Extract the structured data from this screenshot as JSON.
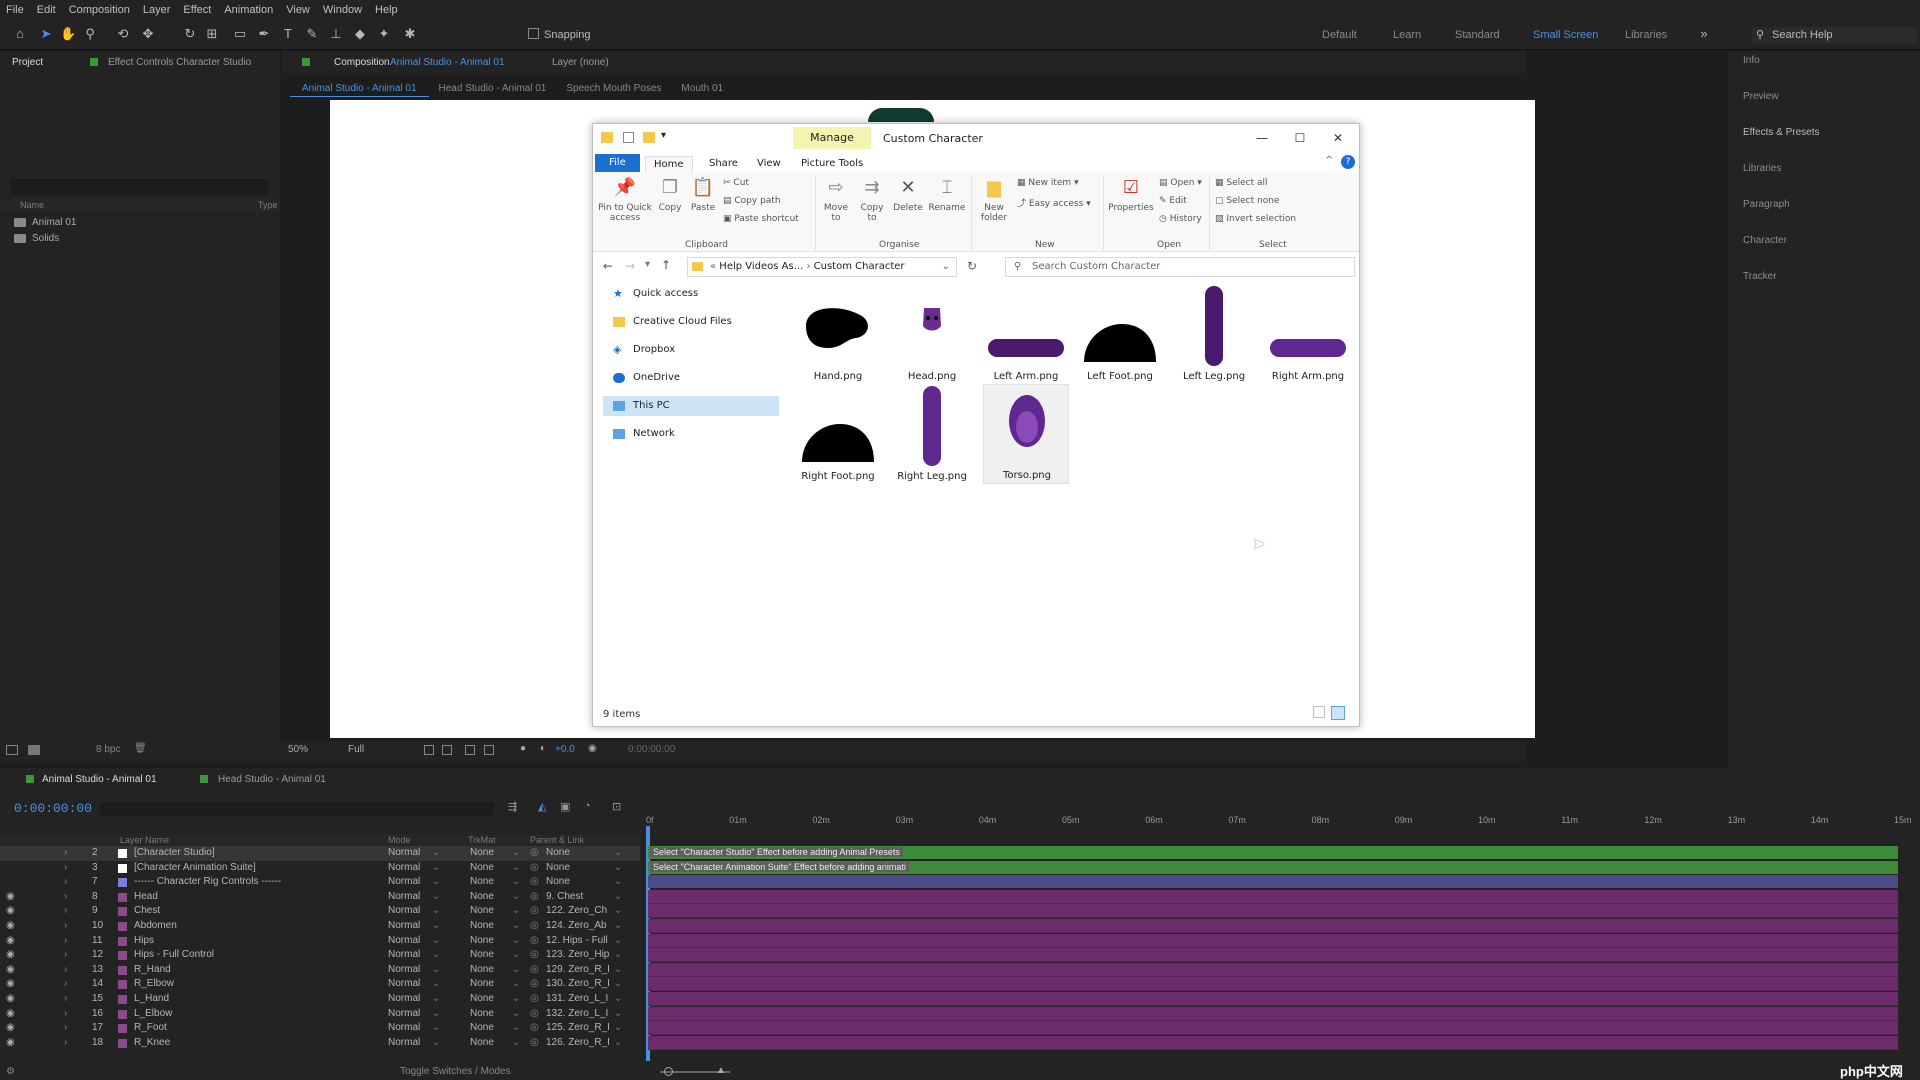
{
  "menu": [
    "File",
    "Edit",
    "Composition",
    "Layer",
    "Effect",
    "Animation",
    "View",
    "Window",
    "Help"
  ],
  "toolbar": {
    "snapping": "Snapping",
    "workspaces": [
      "Default",
      "Learn",
      "Standard",
      "Small Screen",
      "Libraries"
    ],
    "search_help": "Search Help"
  },
  "project_panel": {
    "tab": "Project",
    "effect_controls_tab": "Effect Controls Character Studio",
    "header_name": "Name",
    "header_type": "Type",
    "items": [
      "Animal 01",
      "Solids"
    ]
  },
  "composition": {
    "tab_prefix": "Composition",
    "tab_name": "Animal Studio - Animal 01",
    "layer_tab": "Layer (none)",
    "viewer_tabs": [
      "Animal Studio - Animal 01",
      "Head Studio - Animal 01",
      "Speech Mouth Poses",
      "Mouth 01"
    ]
  },
  "viewer_bar": {
    "zoom": "50%",
    "quality": "Full",
    "exposure": "+0.0",
    "time": "0:00:00:00",
    "bits": "8 bpc"
  },
  "right_panel": [
    "Info",
    "Preview",
    "Effects & Presets",
    "Libraries",
    "Paragraph",
    "Character",
    "Tracker"
  ],
  "explorer": {
    "manage": "Manage",
    "title": "Custom Character",
    "ribbon_tabs": [
      "File",
      "Home",
      "Share",
      "View",
      "Picture Tools"
    ],
    "clipboard": {
      "pin": "Pin to Quick access",
      "copy": "Copy",
      "paste": "Paste",
      "cut": "Cut",
      "copy_path": "Copy path",
      "paste_shortcut": "Paste shortcut",
      "label": "Clipboard"
    },
    "organise": {
      "move": "Move to",
      "copy": "Copy to",
      "delete": "Delete",
      "rename": "Rename",
      "label": "Organise"
    },
    "new": {
      "folder": "New folder",
      "item": "New item",
      "easy": "Easy access",
      "label": "New"
    },
    "open": {
      "properties": "Properties",
      "open": "Open",
      "edit": "Edit",
      "history": "History",
      "label": "Open"
    },
    "select": {
      "all": "Select all",
      "none": "Select none",
      "invert": "Invert selection",
      "label": "Select"
    },
    "address": {
      "parent": "Help Videos As...",
      "current": "Custom Character"
    },
    "search_placeholder": "Search Custom Character",
    "nav": [
      "Quick access",
      "Creative Cloud Files",
      "Dropbox",
      "OneDrive",
      "This PC",
      "Network"
    ],
    "files": [
      "Hand.png",
      "Head.png",
      "Left Arm.png",
      "Left Foot.png",
      "Left Leg.png",
      "Right Arm.png",
      "Right Foot.png",
      "Right Leg.png",
      "Torso.png"
    ],
    "status": "9 items"
  },
  "timeline": {
    "tabs": [
      "Animal Studio - Animal 01",
      "Head Studio - Animal 01"
    ],
    "time": "0:00:00:00",
    "headers": {
      "name": "Layer Name",
      "mode": "Mode",
      "trkmat": "TrkMat",
      "parent": "Parent & Link"
    },
    "ticks": [
      "0f",
      "01m",
      "02m",
      "03m",
      "04m",
      "05m",
      "06m",
      "07m",
      "08m",
      "09m",
      "10m",
      "11m",
      "12m",
      "13m",
      "14m",
      "15m"
    ],
    "notes": [
      "Select \"Character Studio\" Effect before adding Animal Presets",
      "Select \"Character Animation Suite\" Effect before adding animati"
    ],
    "layers": [
      {
        "num": "2",
        "name": "[Character Studio]",
        "mode": "Normal",
        "trk": "None",
        "parent": "None",
        "color": "#ffffff"
      },
      {
        "num": "3",
        "name": "[Character Animation Suite]",
        "mode": "Normal",
        "trk": "None",
        "parent": "None",
        "color": "#ffffff"
      },
      {
        "num": "7",
        "name": "------ Character Rig Controls ------",
        "mode": "Normal",
        "trk": "None",
        "parent": "None",
        "color": "#7d7de0"
      },
      {
        "num": "8",
        "name": "Head",
        "mode": "Normal",
        "trk": "None",
        "parent": "9. Chest",
        "color": "#8a4a8a"
      },
      {
        "num": "9",
        "name": "Chest",
        "mode": "Normal",
        "trk": "None",
        "parent": "122. Zero_Ch",
        "color": "#8a4a8a"
      },
      {
        "num": "10",
        "name": "Abdomen",
        "mode": "Normal",
        "trk": "None",
        "parent": "124. Zero_Ab",
        "color": "#8a4a8a"
      },
      {
        "num": "11",
        "name": "Hips",
        "mode": "Normal",
        "trk": "None",
        "parent": "12. Hips - Full",
        "color": "#8a4a8a"
      },
      {
        "num": "12",
        "name": "Hips - Full Control",
        "mode": "Normal",
        "trk": "None",
        "parent": "123. Zero_Hip",
        "color": "#8a4a8a"
      },
      {
        "num": "13",
        "name": "R_Hand",
        "mode": "Normal",
        "trk": "None",
        "parent": "129. Zero_R_I",
        "color": "#8a4a8a"
      },
      {
        "num": "14",
        "name": "R_Elbow",
        "mode": "Normal",
        "trk": "None",
        "parent": "130. Zero_R_I",
        "color": "#8a4a8a"
      },
      {
        "num": "15",
        "name": "L_Hand",
        "mode": "Normal",
        "trk": "None",
        "parent": "131. Zero_L_I",
        "color": "#8a4a8a"
      },
      {
        "num": "16",
        "name": "L_Elbow",
        "mode": "Normal",
        "trk": "None",
        "parent": "132. Zero_L_I",
        "color": "#8a4a8a"
      },
      {
        "num": "17",
        "name": "R_Foot",
        "mode": "Normal",
        "trk": "None",
        "parent": "125. Zero_R_I",
        "color": "#8a4a8a"
      },
      {
        "num": "18",
        "name": "R_Knee",
        "mode": "Normal",
        "trk": "None",
        "parent": "126. Zero_R_I",
        "color": "#8a4a8a"
      }
    ],
    "footer": "Toggle Switches / Modes"
  },
  "watermark": "php中文网"
}
